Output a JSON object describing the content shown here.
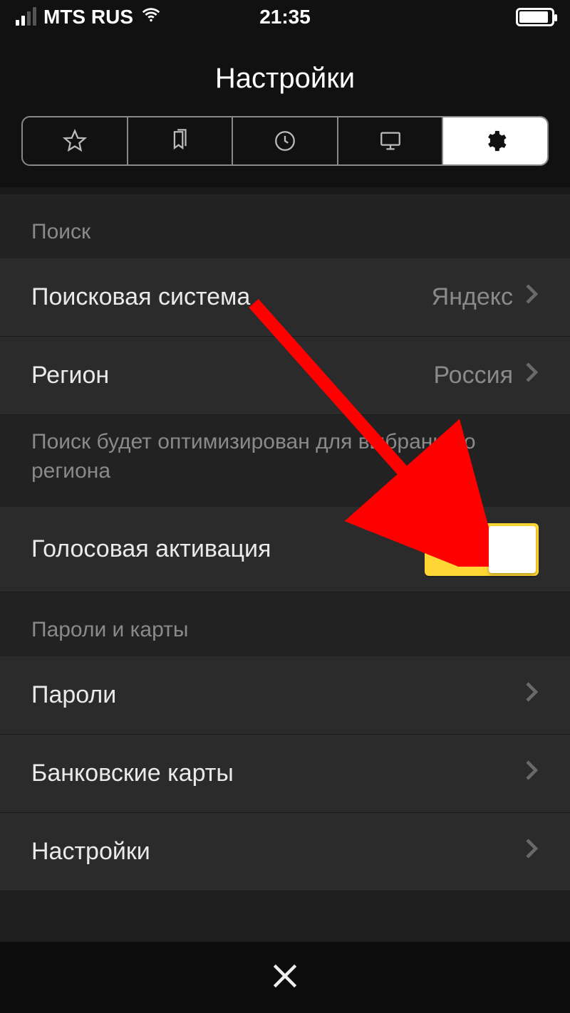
{
  "statusbar": {
    "carrier": "MTS RUS",
    "time": "21:35"
  },
  "header": {
    "title": "Настройки"
  },
  "tabs": {
    "active_index": 4,
    "icons": [
      "star-icon",
      "bookmarks-icon",
      "history-icon",
      "desktop-icon",
      "gear-icon"
    ]
  },
  "sections": [
    {
      "header": "Поиск",
      "rows": [
        {
          "label": "Поисковая система",
          "value": "Яндекс",
          "type": "nav"
        },
        {
          "label": "Регион",
          "value": "Россия",
          "type": "nav"
        }
      ],
      "footer": "Поиск будет оптимизирован для выбранного региона",
      "rows2": [
        {
          "label": "Голосовая активация",
          "type": "toggle",
          "on": true
        }
      ]
    },
    {
      "header": "Пароли и карты",
      "rows": [
        {
          "label": "Пароли",
          "type": "nav"
        },
        {
          "label": "Банковские карты",
          "type": "nav"
        },
        {
          "label": "Настройки",
          "type": "nav"
        }
      ]
    }
  ],
  "annotation": {
    "arrow_color": "#ff0000"
  }
}
